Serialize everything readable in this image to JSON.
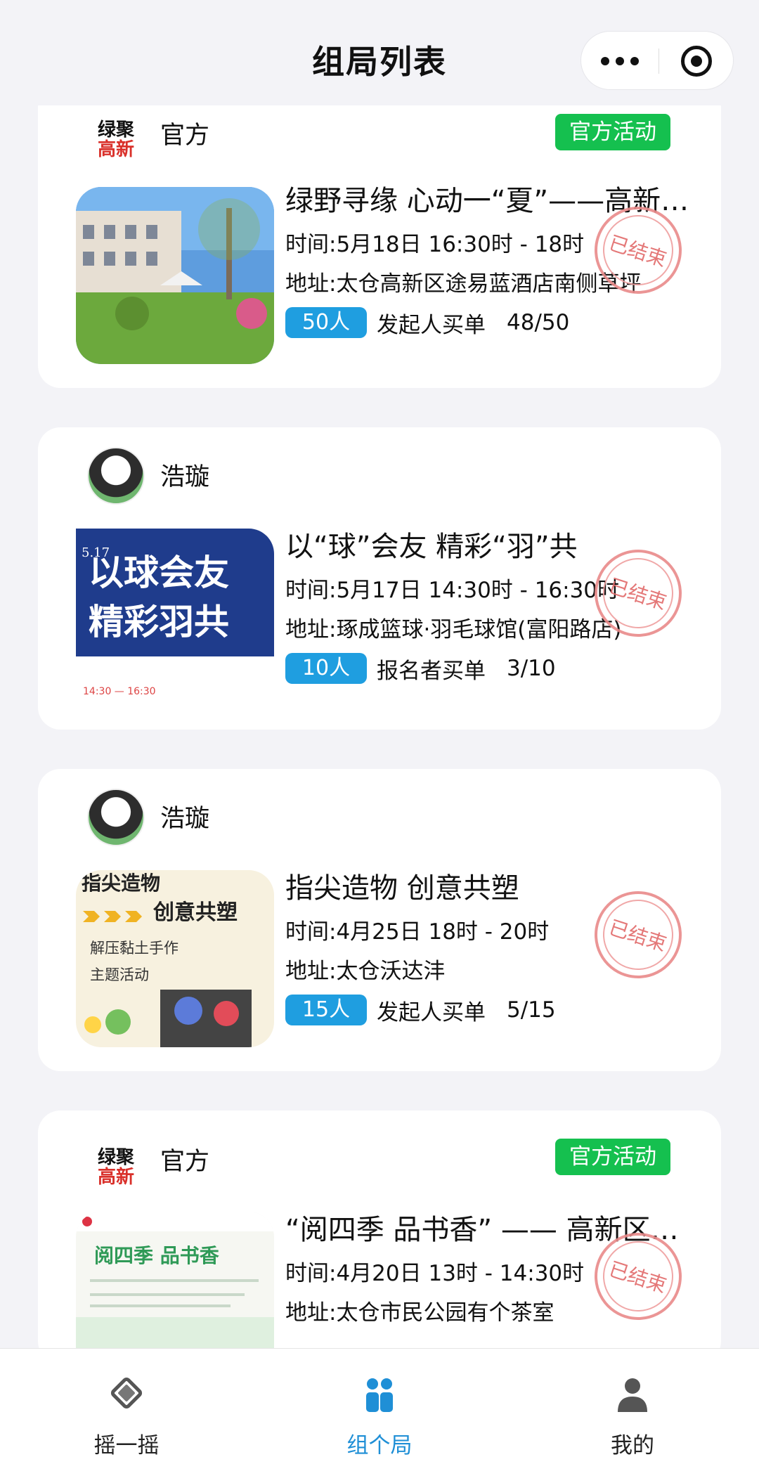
{
  "header": {
    "title": "组局列表"
  },
  "cards": [
    {
      "author": "官方",
      "avatar_text": [
        "绿聚",
        "高新"
      ],
      "official_tag": "官方活动",
      "title": "绿野寻缘 心动一“夏”——高新区青年联谊活动",
      "time": "时间:5月18日 16:30时 - 18时",
      "address": "地址:太仓高新区途易蓝酒店南侧草坪",
      "count": "50人",
      "payer": "发起人买单",
      "progress": "48/50",
      "status": "已结束"
    },
    {
      "author": "浩璇",
      "title": "以“球”会友 精彩“羽”共",
      "time": "时间:5月17日 14:30时 - 16:30时",
      "address": "地址:琢成篮球·羽毛球馆(富阳路店)",
      "count": "10人",
      "payer": "报名者买单",
      "progress": "3/10",
      "status": "已结束",
      "thumb_text": [
        "以球会友",
        "精彩羽共",
        "5.17",
        "14:30 — 16:30"
      ]
    },
    {
      "author": "浩璇",
      "title": "指尖造物 创意共塑",
      "time": "时间:4月25日 18时 - 20时",
      "address": "地址:太仓沃达沣",
      "count": "15人",
      "payer": "发起人买单",
      "progress": "5/15",
      "status": "已结束",
      "thumb_text": [
        "指尖造物",
        "创意共塑",
        "解压黏土手作",
        "主题活动"
      ]
    },
    {
      "author": "官方",
      "avatar_text": [
        "绿聚",
        "高新"
      ],
      "official_tag": "官方活动",
      "title": "“阅四季 品书香” —— 高新区读书分享会",
      "time": "时间:4月20日 13时 - 14:30时",
      "address": "地址:太仓市民公园有个茶室",
      "status": "已结束",
      "thumb_text": [
        "阅四季 品书香"
      ]
    }
  ],
  "tabs": [
    {
      "label": "摇一摇",
      "icon": "shake-icon"
    },
    {
      "label": "组个局",
      "icon": "group-icon"
    },
    {
      "label": "我的",
      "icon": "profile-icon"
    }
  ],
  "colors": {
    "accent": "#1f8fd6",
    "badge": "#1f9ee0",
    "official": "#15c04f",
    "stamp": "#e26a6a"
  }
}
